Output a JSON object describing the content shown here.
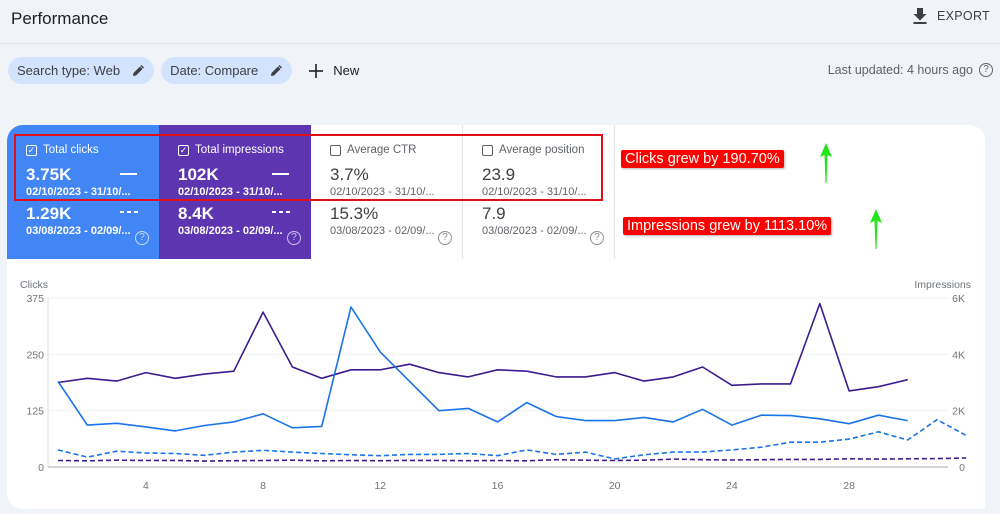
{
  "header": {
    "title": "Performance",
    "export_label": "EXPORT"
  },
  "filters": {
    "chips": [
      {
        "label": "Search type: Web",
        "icon": "edit-icon"
      },
      {
        "label": "Date: Compare",
        "icon": "edit-icon"
      }
    ],
    "new_label": "New",
    "last_updated": "Last updated: 4 hours ago"
  },
  "metrics": [
    {
      "key": "clicks",
      "label": "Total clicks",
      "checked": true,
      "current_value": "3.75K",
      "current_range": "02/10/2023 - 31/10/...",
      "previous_value": "1.29K",
      "previous_range": "03/08/2023 - 02/09/...",
      "color": "#4285f4"
    },
    {
      "key": "impressions",
      "label": "Total impressions",
      "checked": true,
      "current_value": "102K",
      "current_range": "02/10/2023 - 31/10/...",
      "previous_value": "8.4K",
      "previous_range": "03/08/2023 - 02/09/...",
      "color": "#5e35b1"
    },
    {
      "key": "ctr",
      "label": "Average CTR",
      "checked": false,
      "current_value": "3.7%",
      "current_range": "02/10/2023 - 31/10/...",
      "previous_value": "15.3%",
      "previous_range": "03/08/2023 - 02/09/..."
    },
    {
      "key": "position",
      "label": "Average position",
      "checked": false,
      "current_value": "23.9",
      "current_range": "02/10/2023 - 31/10/...",
      "previous_value": "7.9",
      "previous_range": "03/08/2023 - 02/09/..."
    }
  ],
  "annotations": [
    {
      "text": "Clicks grew by 190.70%",
      "color": "#ff0000"
    },
    {
      "text": "Impressions grew by 1113.10%",
      "color": "#ff0000"
    }
  ],
  "chart_data": {
    "type": "line",
    "title": "",
    "xlabel": "",
    "ylabel": "Clicks",
    "y2label": "Impressions",
    "x": [
      1,
      2,
      3,
      4,
      5,
      6,
      7,
      8,
      9,
      10,
      11,
      12,
      13,
      14,
      15,
      16,
      17,
      18,
      19,
      20,
      21,
      22,
      23,
      24,
      25,
      26,
      27,
      28,
      29,
      30,
      31,
      32
    ],
    "x_ticks": [
      "4",
      "8",
      "12",
      "16",
      "20",
      "24",
      "28"
    ],
    "x_tick_values": [
      4,
      8,
      12,
      16,
      20,
      24,
      28
    ],
    "ylim": [
      0,
      375
    ],
    "y_ticks": [
      "0",
      "125",
      "250",
      "375"
    ],
    "y_tick_values": [
      0,
      125,
      250,
      375
    ],
    "y2lim": [
      0,
      6000
    ],
    "y2_ticks": [
      "0",
      "2K",
      "4K",
      "6K"
    ],
    "y2_tick_values": [
      0,
      2000,
      4000,
      6000
    ],
    "grid": true,
    "series": [
      {
        "name": "Clicks (02/10/2023 - 31/10/2023)",
        "axis": "left",
        "style": "solid",
        "color": "#1a73e8",
        "values": [
          190,
          93,
          97,
          89,
          80,
          92,
          100,
          118,
          87,
          90,
          355,
          255,
          190,
          125,
          130,
          100,
          143,
          112,
          103,
          103,
          110,
          100,
          128,
          93,
          115,
          114,
          107,
          96,
          115,
          103,
          null,
          null
        ]
      },
      {
        "name": "Impressions (02/10/2023 - 31/10/2023)",
        "axis": "right",
        "style": "solid",
        "color": "#3c1b8f",
        "values": [
          3000,
          3150,
          3050,
          3350,
          3150,
          3300,
          3400,
          5500,
          3550,
          3150,
          3450,
          3450,
          3650,
          3350,
          3200,
          3450,
          3400,
          3200,
          3200,
          3350,
          3050,
          3200,
          3550,
          2900,
          2950,
          2950,
          5800,
          2700,
          2850,
          3100,
          null,
          null
        ]
      },
      {
        "name": "Clicks (03/08/2023 - 02/09/2023)",
        "axis": "left",
        "style": "dashed",
        "color": "#1a73e8",
        "values": [
          38,
          22,
          35,
          31,
          30,
          26,
          33,
          37,
          33,
          30,
          27,
          25,
          28,
          28,
          30,
          25,
          38,
          28,
          33,
          18,
          27,
          33,
          33,
          38,
          44,
          55,
          55,
          62,
          78,
          60,
          105,
          70
        ]
      },
      {
        "name": "Impressions (03/08/2023 - 02/09/2023)",
        "axis": "right",
        "style": "dashed",
        "color": "#3c1b8f",
        "values": [
          230,
          220,
          240,
          230,
          235,
          210,
          225,
          230,
          240,
          220,
          230,
          225,
          235,
          230,
          225,
          230,
          220,
          260,
          240,
          230,
          240,
          280,
          260,
          250,
          260,
          270,
          270,
          290,
          280,
          290,
          300,
          320
        ]
      }
    ]
  }
}
